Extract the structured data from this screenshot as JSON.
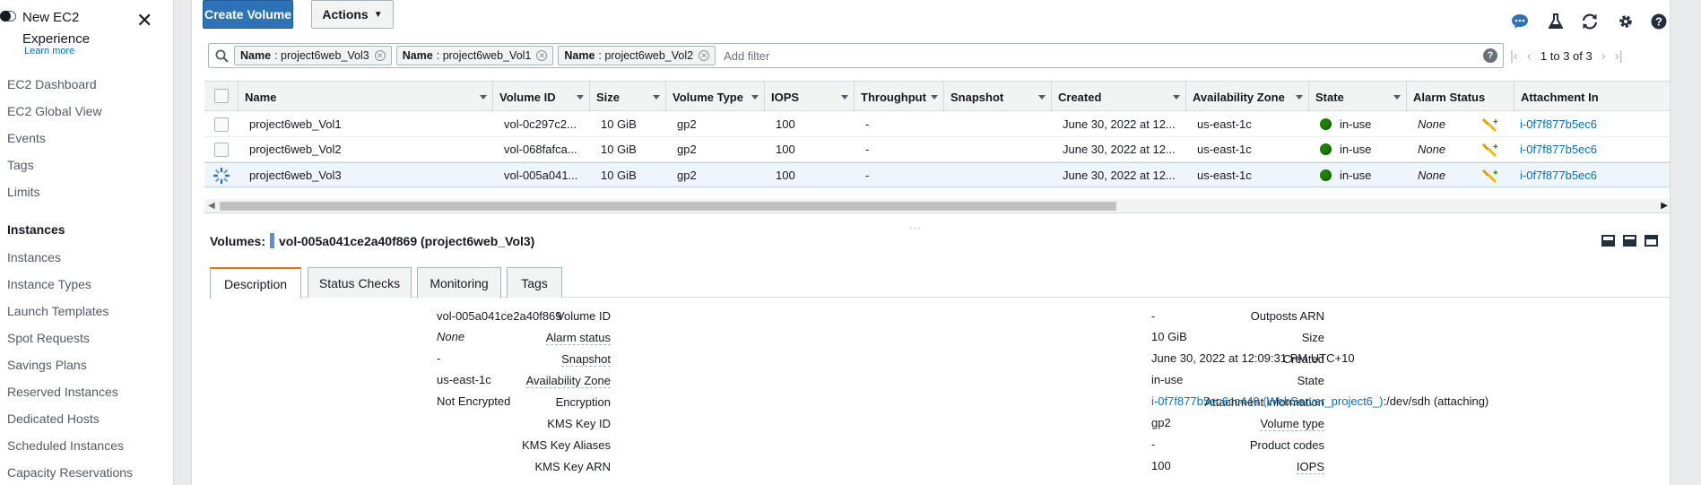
{
  "sidebar": {
    "new_experience": "New EC2 Experience",
    "learn_more": "Learn more",
    "items": [
      "EC2 Dashboard",
      "EC2 Global View",
      "Events",
      "Tags",
      "Limits"
    ],
    "section_instances": "Instances",
    "instance_items": [
      "Instances",
      "Instance Types",
      "Launch Templates",
      "Spot Requests",
      "Savings Plans",
      "Reserved Instances",
      "Dedicated Hosts",
      "Scheduled Instances",
      "Capacity Reservations"
    ]
  },
  "toolbar": {
    "create_volume": "Create Volume",
    "actions": "Actions"
  },
  "top_icons": [
    "chat-icon",
    "flask-icon",
    "refresh-icon",
    "gear-icon",
    "help-icon"
  ],
  "filter": {
    "chips": [
      {
        "key": "Name",
        "value": "project6web_Vol3"
      },
      {
        "key": "Name",
        "value": "project6web_Vol1"
      },
      {
        "key": "Name",
        "value": "project6web_Vol2"
      }
    ],
    "add_filter": "Add filter",
    "pagination": "1 to 3 of 3"
  },
  "table": {
    "columns": [
      "Name",
      "Volume ID",
      "Size",
      "Volume Type",
      "IOPS",
      "Throughput",
      "Snapshot",
      "Created",
      "Availability Zone",
      "State",
      "Alarm Status",
      "Attachment In"
    ],
    "rows": [
      {
        "name": "project6web_Vol1",
        "volume_id": "vol-0c297c2...",
        "size": "10 GiB",
        "type": "gp2",
        "iops": "100",
        "throughput": "-",
        "snapshot": "",
        "created": "June 30, 2022 at 12...",
        "az": "us-east-1c",
        "state": "in-use",
        "alarm": "None",
        "attachment": "i-0f7f877b5ec6"
      },
      {
        "name": "project6web_Vol2",
        "volume_id": "vol-068fafca...",
        "size": "10 GiB",
        "type": "gp2",
        "iops": "100",
        "throughput": "-",
        "snapshot": "",
        "created": "June 30, 2022 at 12...",
        "az": "us-east-1c",
        "state": "in-use",
        "alarm": "None",
        "attachment": "i-0f7f877b5ec6"
      },
      {
        "name": "project6web_Vol3",
        "volume_id": "vol-005a041...",
        "size": "10 GiB",
        "type": "gp2",
        "iops": "100",
        "throughput": "-",
        "snapshot": "",
        "created": "June 30, 2022 at 12...",
        "az": "us-east-1c",
        "state": "in-use",
        "alarm": "None",
        "attachment": "i-0f7f877b5ec6"
      }
    ]
  },
  "detail": {
    "title_prefix": "Volumes:",
    "title": "vol-005a041ce2a40f869 (project6web_Vol3)",
    "tabs": [
      "Description",
      "Status Checks",
      "Monitoring",
      "Tags"
    ],
    "left": [
      {
        "label": "Volume ID",
        "value": "vol-005a041ce2a40f869"
      },
      {
        "label": "Alarm status",
        "value": "None"
      },
      {
        "label": "Snapshot",
        "value": "-"
      },
      {
        "label": "Availability Zone",
        "value": "us-east-1c"
      },
      {
        "label": "Encryption",
        "value": "Not Encrypted"
      },
      {
        "label": "KMS Key ID",
        "value": ""
      },
      {
        "label": "KMS Key Aliases",
        "value": ""
      },
      {
        "label": "KMS Key ARN",
        "value": ""
      }
    ],
    "right": [
      {
        "label": "Outposts ARN",
        "value": "-"
      },
      {
        "label": "Size",
        "value": "10 GiB"
      },
      {
        "label": "Created",
        "value": "June 30, 2022 at 12:09:31 PM UTC+10"
      },
      {
        "label": "State",
        "value": "in-use"
      },
      {
        "label": "Attachment information",
        "value_link": "i-0f7f877b5ec6cc449 (WebServer_project6_)",
        "value": ":/dev/sdh (attaching)"
      },
      {
        "label": "Volume type",
        "value": "gp2"
      },
      {
        "label": "Product codes",
        "value": "-"
      },
      {
        "label": "IOPS",
        "value": "100"
      }
    ]
  },
  "colors": {
    "primary": "#2e73b8",
    "link": "#0073bb",
    "status_ok": "#1d8102",
    "tab_accent": "#ec7211"
  }
}
